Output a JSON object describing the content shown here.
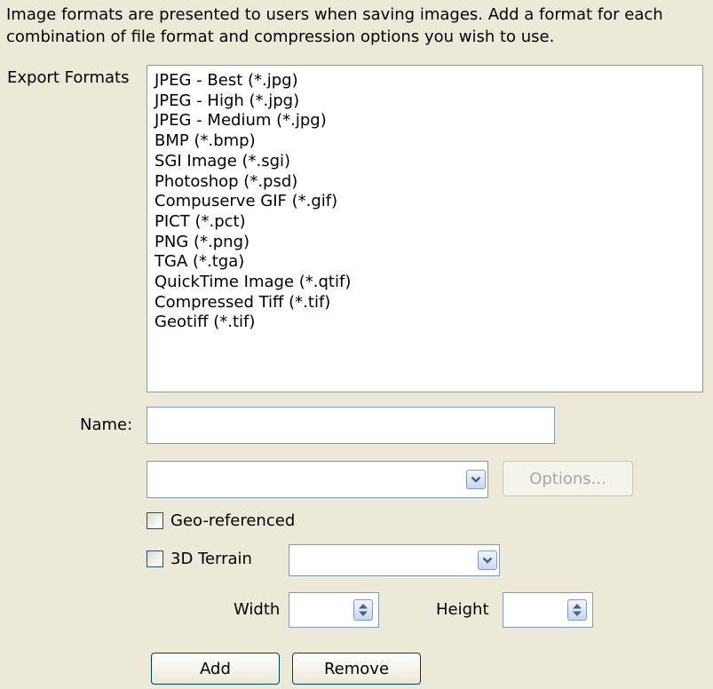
{
  "description": "Image formats are presented to users when saving images. Add a format for each combination of file format and compression options you wish to use.",
  "export_formats": {
    "label": "Export Formats",
    "items": [
      "JPEG - Best (*.jpg)",
      "JPEG - High (*.jpg)",
      "JPEG - Medium (*.jpg)",
      "BMP (*.bmp)",
      "SGI Image (*.sgi)",
      "Photoshop (*.psd)",
      "Compuserve GIF (*.gif)",
      "PICT (*.pct)",
      "PNG (*.png)",
      "TGA (*.tga)",
      "QuickTime Image (*.qtif)",
      "Compressed Tiff (*.tif)",
      "Geotiff (*.tif)"
    ]
  },
  "name": {
    "label": "Name:",
    "value": ""
  },
  "format_select": {
    "value": "",
    "icon": "chevron-down-icon"
  },
  "options_button": {
    "label": "Options...",
    "enabled": false
  },
  "geo_referenced": {
    "label": "Geo-referenced",
    "checked": false
  },
  "terrain_3d": {
    "label": "3D Terrain",
    "checked": false,
    "select_value": ""
  },
  "width": {
    "label": "Width",
    "value": ""
  },
  "height": {
    "label": "Height",
    "value": ""
  },
  "buttons": {
    "add": "Add",
    "remove": "Remove"
  },
  "colors": {
    "background": "#ece9d8",
    "field_border": "#7f9db9",
    "button_border": "#003c74",
    "disabled_text": "#a7a6aa"
  }
}
